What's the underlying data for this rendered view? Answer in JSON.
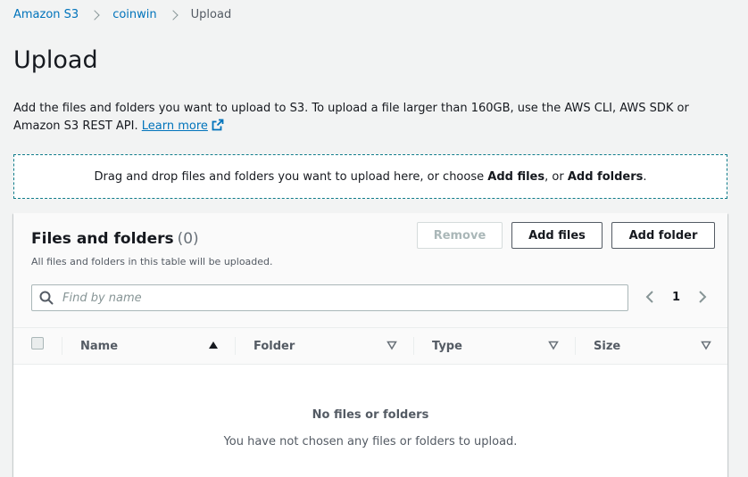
{
  "breadcrumb": {
    "items": [
      "Amazon S3",
      "coinwin"
    ],
    "current": "Upload"
  },
  "page": {
    "title": "Upload",
    "description": "Add the files and folders you want to upload to S3. To upload a file larger than 160GB, use the AWS CLI, AWS SDK or Amazon S3 REST API.",
    "learn_more": "Learn more"
  },
  "dropzone": {
    "text_prefix": "Drag and drop files and folders you want to upload here, or choose",
    "add_files": "Add files",
    "text_middle": ", or",
    "add_folders": "Add folders",
    "text_suffix": "."
  },
  "files_panel": {
    "title": "Files and folders",
    "count": "(0)",
    "subtitle": "All files and folders in this table will be uploaded.",
    "buttons": {
      "remove": "Remove",
      "add_files": "Add files",
      "add_folder": "Add folder"
    },
    "search": {
      "placeholder": "Find by name",
      "value": ""
    },
    "pagination": {
      "page": "1"
    },
    "columns": [
      "Name",
      "Folder",
      "Type",
      "Size"
    ],
    "empty": {
      "title": "No files or folders",
      "text": "You have not chosen any files or folders to upload."
    }
  },
  "colors": {
    "link": "#0073bb",
    "dropzone_border": "#0f7c8a",
    "background": "#f2f3f3"
  },
  "icons": {
    "breadcrumb_separator": "chevron-right-icon",
    "external_link": "external-link-icon",
    "search": "search-icon",
    "prev": "chevron-left-icon",
    "next": "chevron-right-icon",
    "sort_asc": "sort-ascending-icon",
    "sort": "sort-descending-icon"
  }
}
